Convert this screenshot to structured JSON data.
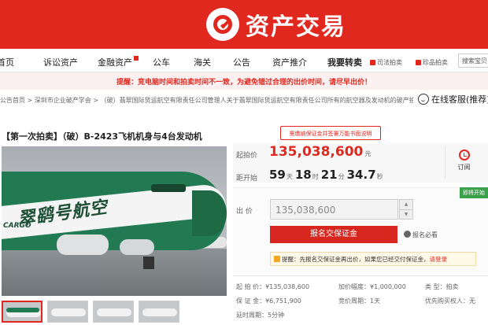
{
  "header": {
    "brand": "资产交易",
    "colors": {
      "brand_red": "#e0281f",
      "badge_green": "#3aa14a"
    }
  },
  "nav": {
    "items": [
      "首页",
      "诉讼资产",
      "金融资产",
      "公车",
      "海关",
      "公告",
      "资产推介",
      "我要转卖"
    ],
    "small_links": [
      "司法拍卖",
      "珍品拍卖"
    ],
    "search_placeholder": "搜索宝贝"
  },
  "alert": "提醒：竞电脑时间和拍卖时间不一致，为避免错过合理的出价时间，请尽早出价！",
  "breadcrumb": {
    "path": "公告首页 > 深圳市企业破产学会 > （破）翡翠国际货运航空有限责任公司管理人关于翡翠国际货运航空有限责任公司所有的航空器及发动机的破产拍卖公告",
    "service_label": "在线客服(推荐)"
  },
  "listing": {
    "title": "【第一次拍卖】（破）B-2423飞机机身与4台发动机",
    "deposit_note": "需缴纳保证金并签署万能书面说明",
    "start_price_label": "起拍价",
    "start_price": "135,038,600",
    "currency_unit": "元",
    "countdown_label": "距开始",
    "countdown": {
      "days": "59",
      "days_unit": "天",
      "hours": "18",
      "hours_unit": "时",
      "minutes": "21",
      "minutes_unit": "分",
      "seconds": "34.7",
      "seconds_unit": "秒"
    },
    "remind_label": "订阅",
    "badge": "即将开始",
    "bid_label": "出 价",
    "bid_value": "135,038,600",
    "signup_button": "报名交保证金",
    "must_read": "报名必看",
    "tip_prefix": "提醒：先报名交保证金再出价，如果您已经交付保证金，",
    "tip_link": "请登录",
    "image_text": {
      "callsign": "翠鹞号航空",
      "cargo": "CARGO"
    }
  },
  "details": {
    "start_price": "起 拍 价：¥135,038,600",
    "deposit": "保 证 金：¥6,751,900",
    "delay": "延时周期：5分钟",
    "increment": "加价幅度：¥1,000,000",
    "cycle": "竞价周期：1天",
    "type": "类 型：拍卖",
    "priority": "优先购买权人：无"
  }
}
